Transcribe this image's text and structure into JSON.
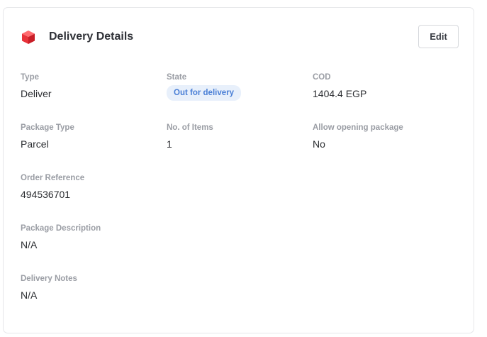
{
  "card": {
    "title": "Delivery Details",
    "icon": "package-cube-icon",
    "edit_label": "Edit"
  },
  "fields": {
    "type": {
      "label": "Type",
      "value": "Deliver"
    },
    "state": {
      "label": "State",
      "value": "Out for delivery",
      "color": "#4a7fd6",
      "background": "#e8f0fb"
    },
    "cod": {
      "label": "COD",
      "value": "1404.4 EGP"
    },
    "package_type": {
      "label": "Package Type",
      "value": "Parcel"
    },
    "items": {
      "label": "No. of Items",
      "value": "1"
    },
    "allow_opening": {
      "label": "Allow opening package",
      "value": "No"
    },
    "order_reference": {
      "label": "Order Reference",
      "value": "494536701"
    },
    "package_description": {
      "label": "Package Description",
      "value": "N/A"
    },
    "delivery_notes": {
      "label": "Delivery Notes",
      "value": "N/A"
    }
  },
  "colors": {
    "icon_red": "#e8333a",
    "title": "#2f3137",
    "label": "#9a9da4",
    "value": "#2b2d31"
  }
}
